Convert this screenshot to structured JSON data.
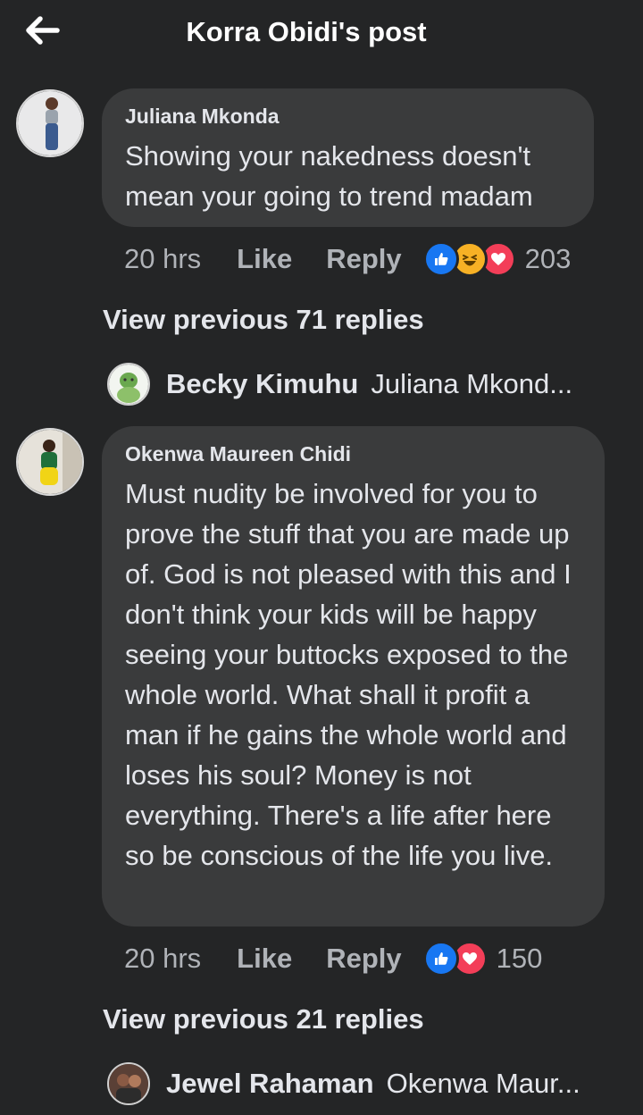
{
  "header": {
    "title": "Korra Obidi's post"
  },
  "comments": [
    {
      "author": "Juliana Mkonda",
      "text": "Showing your nakedness doesn't mean your going to trend madam",
      "time": "20 hrs",
      "like_label": "Like",
      "reply_label": "Reply",
      "reactions": [
        "like-icon",
        "haha-icon",
        "love-icon"
      ],
      "reaction_count": "203",
      "view_more": "View previous 71 replies",
      "latest_reply": {
        "name": "Becky Kimuhu",
        "snippet": "Juliana Mkond..."
      }
    },
    {
      "author": "Okenwa Maureen Chidi",
      "text": "Must nudity be involved for you to prove the stuff that you are made up of. God is not pleased with this and I don't think your kids will be happy seeing your buttocks exposed to the whole world. What shall it profit a man if he gains the whole world and loses his soul? Money is not everything. There's a life after here so be conscious of the life you live.",
      "time": "20 hrs",
      "like_label": "Like",
      "reply_label": "Reply",
      "reactions": [
        "like-icon",
        "love-icon"
      ],
      "reaction_count": "150",
      "view_more": "View previous 21 replies",
      "latest_reply": {
        "name": "Jewel Rahaman",
        "snippet": "Okenwa Maur..."
      }
    }
  ],
  "colors": {
    "background": "#242526",
    "bubble": "#3a3b3c",
    "text": "#e4e6eb",
    "muted": "#b0b3b8",
    "like_blue": "#1877f2",
    "love_red": "#f33e58",
    "haha_yellow": "#f7b125"
  }
}
